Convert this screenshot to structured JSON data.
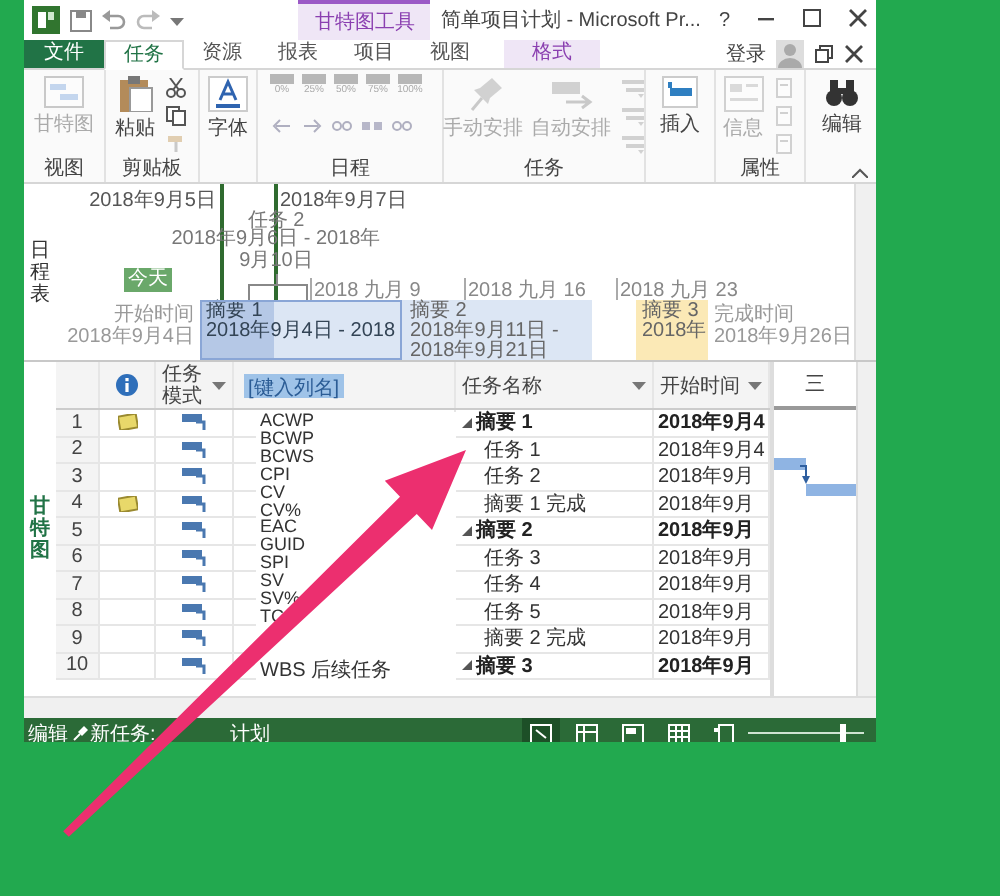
{
  "title_bar": {
    "context_label": "甘特图工具",
    "title": "简单项目计划 - Microsoft Pr...",
    "help": "?"
  },
  "tabs": [
    {
      "label": "文件",
      "kind": "file",
      "selected": false
    },
    {
      "label": "任务",
      "kind": "normal",
      "selected": true
    },
    {
      "label": "资源",
      "kind": "normal",
      "selected": false
    },
    {
      "label": "报表",
      "kind": "normal",
      "selected": false
    },
    {
      "label": "项目",
      "kind": "normal",
      "selected": false
    },
    {
      "label": "视图",
      "kind": "normal",
      "selected": false
    },
    {
      "label": "格式",
      "kind": "contextual",
      "selected": false
    }
  ],
  "account": {
    "label": "登录"
  },
  "ribbon_groups": [
    {
      "label": "视图",
      "buttons": [
        {
          "kind": "large",
          "label": "甘特图",
          "disabled": true
        }
      ]
    },
    {
      "label": "剪贴板",
      "buttons": [
        {
          "kind": "large",
          "label": "粘贴",
          "disabled": false
        },
        {
          "kind": "small",
          "disabled": false
        },
        {
          "kind": "small",
          "disabled": false
        },
        {
          "kind": "small",
          "disabled": true
        }
      ]
    },
    {
      "buttons": [
        {
          "kind": "large",
          "label": "字体",
          "disabled": false
        }
      ]
    },
    {
      "label": "日程",
      "buttons": [
        {
          "kind": "percent",
          "label": "0%",
          "disabled": true
        },
        {
          "kind": "percent",
          "label": "25%",
          "disabled": true
        },
        {
          "kind": "percent",
          "label": "50%",
          "disabled": true
        },
        {
          "kind": "percent",
          "label": "75%",
          "disabled": true
        },
        {
          "kind": "percent",
          "label": "100%",
          "disabled": true
        },
        {
          "kind": "small",
          "disabled": true
        },
        {
          "kind": "small",
          "disabled": true
        },
        {
          "kind": "small",
          "disabled": true
        },
        {
          "kind": "small",
          "disabled": true
        },
        {
          "kind": "small",
          "disabled": true
        }
      ]
    },
    {
      "label": "任务",
      "buttons": [
        {
          "kind": "large",
          "label": "手动安排",
          "disabled": true
        },
        {
          "kind": "large",
          "label": "自动安排",
          "disabled": true
        },
        {
          "kind": "small",
          "disabled": true
        },
        {
          "kind": "small",
          "disabled": true
        },
        {
          "kind": "small",
          "disabled": true
        }
      ]
    },
    {
      "buttons": [
        {
          "kind": "large",
          "label": "插入",
          "disabled": false
        }
      ]
    },
    {
      "label": "属性",
      "buttons": [
        {
          "kind": "large",
          "label": "信息",
          "disabled": true
        },
        {
          "kind": "small",
          "disabled": true
        },
        {
          "kind": "small",
          "disabled": true
        },
        {
          "kind": "small",
          "disabled": true
        }
      ]
    },
    {
      "buttons": [
        {
          "kind": "large",
          "label": "编辑",
          "disabled": false
        }
      ]
    }
  ],
  "timeline": {
    "side_label": "日程表",
    "markers": [
      "2018年9月5日",
      "2018年9月7日"
    ],
    "callout": {
      "name": "任务 2",
      "dates": "2018年9月6日 - 2018年9月10日"
    },
    "today": "今天",
    "scale": [
      "2018 九月 9",
      "2018 九月 16",
      "2018 九月 23"
    ],
    "start": {
      "label": "开始时间",
      "date": "2018年9月4日"
    },
    "finish": {
      "label": "完成时间",
      "date": "2018年9月26日"
    },
    "bars": [
      {
        "name": "摘要 1",
        "dates": "2018年9月4日 - 2018",
        "color": "#b5c8e6",
        "selected": true
      },
      {
        "name": "摘要 2",
        "dates": "2018年9月11日 - 2018年9月21日",
        "color": "#dce6f4",
        "selected": false
      },
      {
        "name": "摘要 3",
        "dates": "2018年",
        "color": "#fbe9b6",
        "selected": false
      }
    ]
  },
  "table": {
    "side_label": "甘特图",
    "columns": [
      {
        "kind": "info"
      },
      {
        "kind": "text",
        "label": "任务模式"
      },
      {
        "kind": "new",
        "label": "[键入列名]"
      },
      {
        "kind": "text",
        "label": "任务名称"
      },
      {
        "kind": "text",
        "label": "开始时间"
      }
    ],
    "rows": [
      {
        "number": "1",
        "note": true,
        "kind": "summary",
        "name": "摘要 1",
        "start": "2018年9月4",
        "expanded": true
      },
      {
        "number": "2",
        "note": false,
        "kind": "task",
        "name": "任务 1",
        "start": "2018年9月4"
      },
      {
        "number": "3",
        "note": false,
        "kind": "task",
        "name": "任务 2",
        "start": "2018年9月"
      },
      {
        "number": "4",
        "note": true,
        "kind": "task",
        "name": "摘要 1 完成",
        "start": "2018年9月"
      },
      {
        "number": "5",
        "note": false,
        "kind": "summary",
        "name": "摘要 2",
        "start": "2018年9月",
        "expanded": true
      },
      {
        "number": "6",
        "note": false,
        "kind": "task",
        "name": "任务 3",
        "start": "2018年9月"
      },
      {
        "number": "7",
        "note": false,
        "kind": "task",
        "name": "任务 4",
        "start": "2018年9月"
      },
      {
        "number": "8",
        "note": false,
        "kind": "task",
        "name": "任务 5",
        "start": "2018年9月"
      },
      {
        "number": "9",
        "note": false,
        "kind": "task",
        "name": "摘要 2 完成",
        "start": "2018年9月"
      },
      {
        "number": "10",
        "note": false,
        "kind": "summary",
        "name": "摘要 3",
        "start": "2018年9月",
        "expanded": true
      }
    ],
    "field_list": [
      "ACWP",
      "BCWP",
      "BCWS",
      "CPI",
      "CV",
      "CV%",
      "EAC",
      "GUID",
      "SPI",
      "SV",
      "SV%",
      "TC",
      "WBS 后续任务"
    ]
  },
  "gantt": {
    "timescale": "三"
  },
  "status_bar": {
    "mode": "编辑",
    "new_tasks": "新任务:",
    "new_tasks_mode": "计划",
    "views": [
      {
        "selected": true
      },
      {
        "selected": false
      },
      {
        "selected": false
      },
      {
        "selected": false
      },
      {
        "selected": false
      }
    ],
    "zoom": {
      "level": 0.82
    }
  }
}
